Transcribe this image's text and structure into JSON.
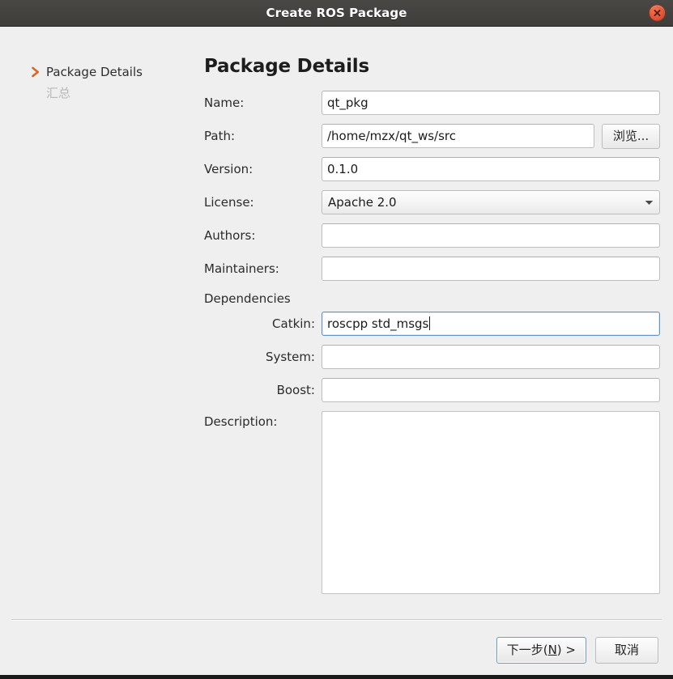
{
  "window": {
    "title": "Create ROS Package",
    "close_icon": "close-icon"
  },
  "sidebar": {
    "items": [
      {
        "label": "Package Details",
        "state": "active",
        "icon": "chevron-right-icon"
      },
      {
        "label": "汇总",
        "state": "disabled",
        "icon": ""
      }
    ]
  },
  "pane": {
    "title": "Package Details",
    "fields": {
      "name": {
        "label": "Name:",
        "value": "qt_pkg",
        "placeholder": ""
      },
      "path": {
        "label": "Path:",
        "value": "/home/mzx/qt_ws/src",
        "placeholder": "",
        "browse_label": "浏览..."
      },
      "version": {
        "label": "Version:",
        "value": "0.1.0",
        "placeholder": ""
      },
      "license": {
        "label": "License:",
        "value": "Apache 2.0",
        "arrow_icon": "chevron-down-icon"
      },
      "authors": {
        "label": "Authors:",
        "value": "",
        "placeholder": ""
      },
      "maintainers": {
        "label": "Maintainers:",
        "value": "",
        "placeholder": ""
      },
      "dependencies_heading": "Dependencies",
      "catkin": {
        "label": "Catkin:",
        "value": "roscpp std_msgs",
        "placeholder": "",
        "focused": true
      },
      "system": {
        "label": "System:",
        "value": "",
        "placeholder": ""
      },
      "boost": {
        "label": "Boost:",
        "value": "",
        "placeholder": ""
      },
      "description": {
        "label": "Description:",
        "value": "",
        "placeholder": ""
      }
    }
  },
  "footer": {
    "next_prefix": "下一步(",
    "next_accel": "N",
    "next_suffix": ") >",
    "cancel_label": "取消"
  },
  "colors": {
    "titlebar": "#413f3c",
    "accent_orange": "#dd6520",
    "focus_blue": "#5f93c9",
    "background": "#efefef"
  }
}
